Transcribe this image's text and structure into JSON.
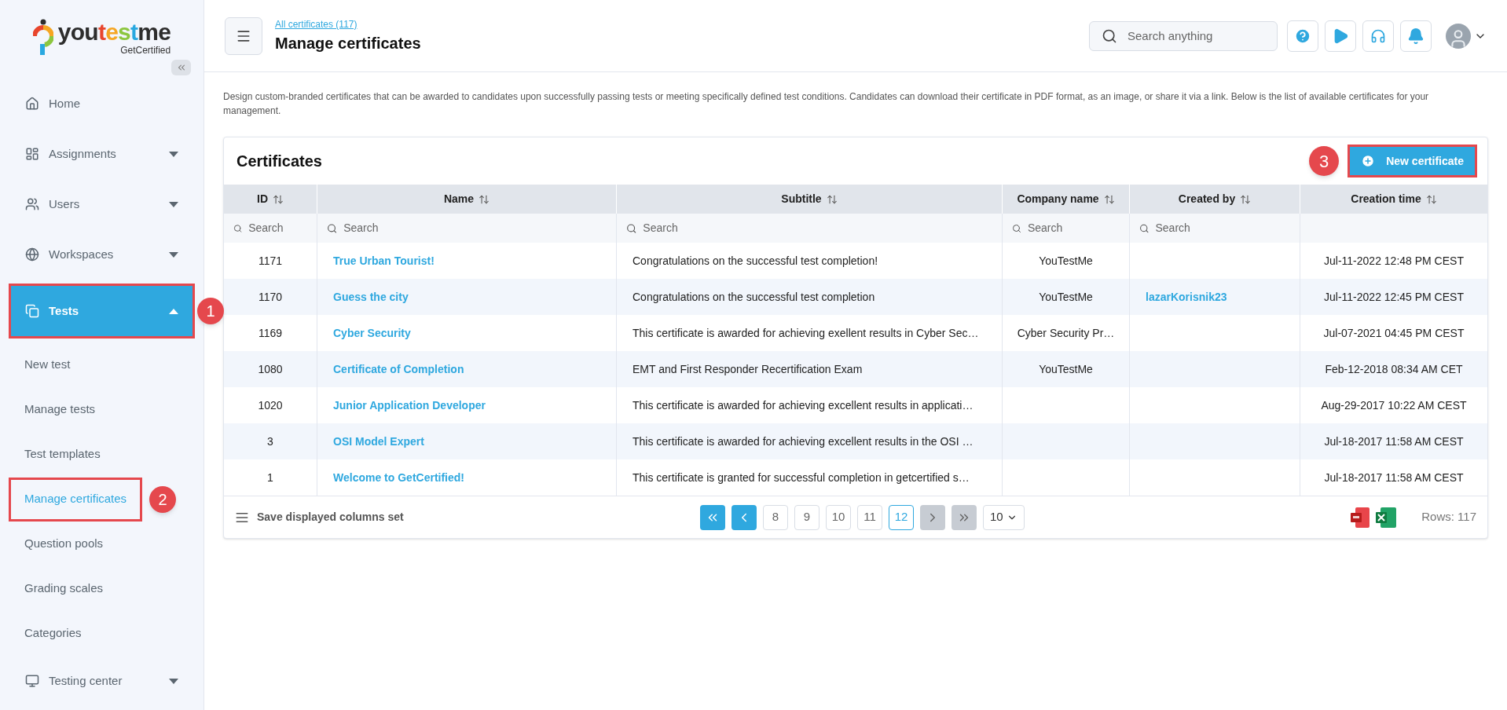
{
  "logo": {
    "parts": [
      {
        "text": "you",
        "color": "#2d2d2d"
      },
      {
        "text": "t",
        "color": "#e8452c"
      },
      {
        "text": "e",
        "color": "#f5a623"
      },
      {
        "text": "s",
        "color": "#8cc63f"
      },
      {
        "text": "t",
        "color": "#29a8e0"
      },
      {
        "text": "me",
        "color": "#2d2d2d"
      }
    ],
    "tagline": "GetCertified"
  },
  "sidebar": {
    "items": [
      {
        "label": "Home",
        "has_caret": false,
        "selected": false
      },
      {
        "label": "Assignments",
        "has_caret": true,
        "expanded": false,
        "selected": false
      },
      {
        "label": "Users",
        "has_caret": true,
        "expanded": false,
        "selected": false
      },
      {
        "label": "Workspaces",
        "has_caret": true,
        "expanded": false,
        "selected": false
      },
      {
        "label": "Tests",
        "has_caret": true,
        "expanded": true,
        "selected": true,
        "callout": "1",
        "children": [
          {
            "label": "New test",
            "selected": false
          },
          {
            "label": "Manage tests",
            "selected": false
          },
          {
            "label": "Test templates",
            "selected": false
          },
          {
            "label": "Manage certificates",
            "selected": true,
            "callout": "2"
          },
          {
            "label": "Question pools",
            "selected": false
          },
          {
            "label": "Grading scales",
            "selected": false
          },
          {
            "label": "Categories",
            "selected": false
          }
        ]
      },
      {
        "label": "Testing center",
        "has_caret": true,
        "expanded": false,
        "selected": false
      }
    ]
  },
  "header": {
    "breadcrumb": "All certificates (117)",
    "title": "Manage certificates",
    "search": {
      "placeholder": "Search anything"
    }
  },
  "description": "Design custom-branded certificates that can be awarded to candidates upon successfully passing tests or meeting specifically defined test conditions. Candidates can download their certificate in PDF format, as an image, or share it via a link. Below is the list of available certificates for your management.",
  "card": {
    "title": "Certificates",
    "new_button": {
      "label": "New certificate",
      "callout": "3"
    }
  },
  "table": {
    "columns": [
      {
        "label": "ID",
        "search_placeholder": "Search"
      },
      {
        "label": "Name",
        "search_placeholder": "Search"
      },
      {
        "label": "Subtitle",
        "search_placeholder": "Search"
      },
      {
        "label": "Company name",
        "search_placeholder": "Search"
      },
      {
        "label": "Created by",
        "search_placeholder": "Search"
      },
      {
        "label": "Creation time"
      }
    ],
    "rows": [
      {
        "id": "1171",
        "name": "True Urban Tourist!",
        "subtitle": "Congratulations on the successful test completion!",
        "company": "YouTestMe",
        "created_by": "",
        "creation_time": "Jul-11-2022 12:48 PM CEST"
      },
      {
        "id": "1170",
        "name": "Guess the city",
        "subtitle": "Congratulations on the successful test completion",
        "company": "YouTestMe",
        "created_by": "lazarKorisnik23",
        "creation_time": "Jul-11-2022 12:45 PM CEST"
      },
      {
        "id": "1169",
        "name": "Cyber Security",
        "subtitle": "This certificate is awarded for achieving exellent results in Cyber Sec…",
        "company": "Cyber Security Pr…",
        "created_by": "",
        "creation_time": "Jul-07-2021 04:45 PM CEST"
      },
      {
        "id": "1080",
        "name": "Certificate of Completion",
        "subtitle": "EMT and First Responder Recertification Exam",
        "company": "YouTestMe",
        "created_by": "",
        "creation_time": "Feb-12-2018 08:34 AM CET"
      },
      {
        "id": "1020",
        "name": "Junior Application Developer",
        "subtitle": "This certificate is awarded for achieving excellent results in applicati…",
        "company": "",
        "created_by": "",
        "creation_time": "Aug-29-2017 10:22 AM CEST"
      },
      {
        "id": "3",
        "name": "OSI Model Expert",
        "subtitle": "This certificate is awarded for achieving excellent results in the OSI …",
        "company": "",
        "created_by": "",
        "creation_time": "Jul-18-2017 11:58 AM CEST"
      },
      {
        "id": "1",
        "name": "Welcome to GetCertified!",
        "subtitle": "This certificate is granted for successful completion in getcertified s…",
        "company": "",
        "created_by": "",
        "creation_time": "Jul-18-2017 11:58 AM CEST"
      }
    ]
  },
  "footer": {
    "save_columns": "Save displayed columns set",
    "first_disabled": false,
    "prev_disabled": false,
    "next_disabled": true,
    "last_disabled": true,
    "pages": [
      {
        "label": "8",
        "selected": false
      },
      {
        "label": "9",
        "selected": false
      },
      {
        "label": "10",
        "selected": false
      },
      {
        "label": "11",
        "selected": false
      },
      {
        "label": "12",
        "selected": true
      }
    ],
    "page_size": "10",
    "rows_count": "Rows: 117"
  }
}
